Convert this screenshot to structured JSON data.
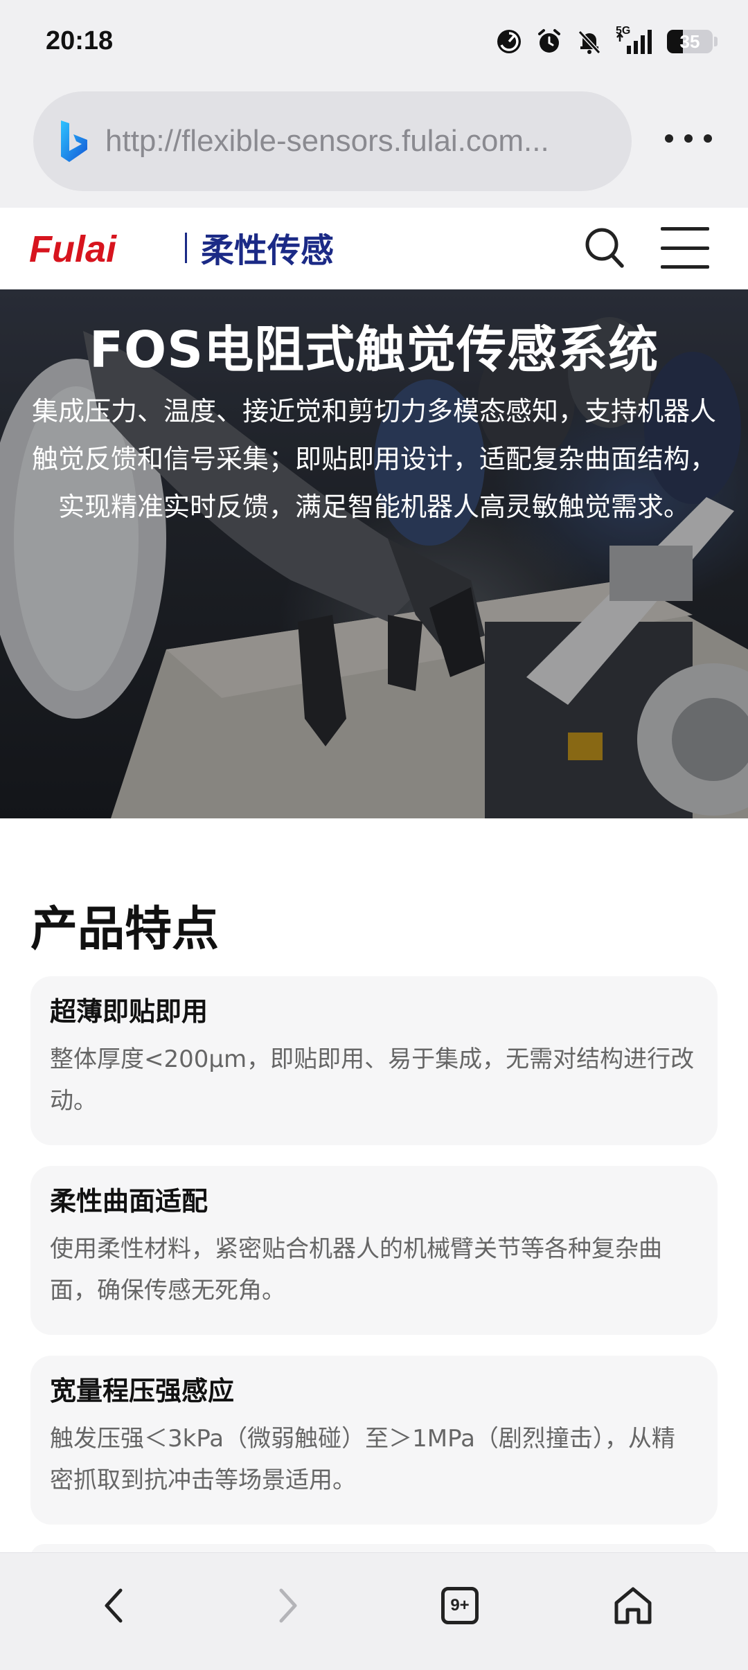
{
  "status_bar": {
    "time": "20:18",
    "network": "5G",
    "battery_level": "35",
    "battery_fraction": 0.35,
    "icons": [
      "data-saver-icon",
      "alarm-icon",
      "mute-icon",
      "signal-icon",
      "battery-icon"
    ]
  },
  "browser": {
    "url": "http://flexible-sensors.fulai.com...",
    "engine_icon": "bing-icon",
    "tab_count": "9+"
  },
  "site": {
    "logo_brand": "Fulai",
    "logo_subtitle": "柔性传感"
  },
  "hero": {
    "title": "FOS电阻式触觉传感系统",
    "description": "集成压力、温度、接近觉和剪切力多模态感知，支持机器人触觉反馈和信号采集；即贴即用设计，适配复杂曲面结构，实现精准实时反馈，满足智能机器人高灵敏触觉需求。"
  },
  "features": {
    "section_title": "产品特点",
    "items": [
      {
        "title": "超薄即贴即用",
        "desc": "整体厚度<200μm，即贴即用、易于集成，无需对结构进行改动。"
      },
      {
        "title": "柔性曲面适配",
        "desc": "使用柔性材料，紧密贴合机器人的机械臂关节等各种复杂曲面，确保传感无死角。"
      },
      {
        "title": "宽量程压强感应",
        "desc": "触发压强＜3kPa（微弱触碰）至＞1MPa（剧烈撞击），从精密抓取到抗冲击等场景适用。"
      }
    ]
  },
  "colors": {
    "logo_red": "#d7141e",
    "logo_blue": "#1b2a86",
    "bing_blue": "#1a8fe0"
  }
}
